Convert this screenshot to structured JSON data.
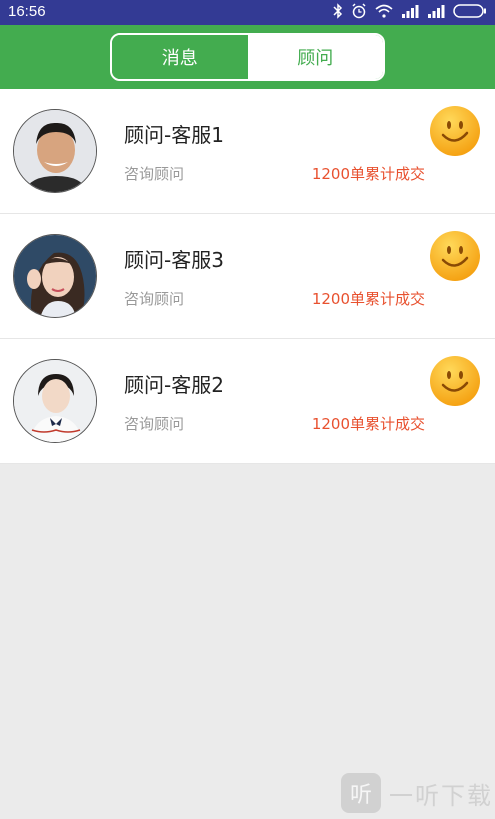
{
  "status_bar": {
    "time": "16:56"
  },
  "tabs": [
    {
      "label": "消息",
      "active": false
    },
    {
      "label": "顾问",
      "active": true
    }
  ],
  "advisors": [
    {
      "name": "顾问-客服1",
      "role": "咨询顾问",
      "deals": "1200单累计成交"
    },
    {
      "name": "顾问-客服3",
      "role": "咨询顾问",
      "deals": "1200单累计成交"
    },
    {
      "name": "顾问-客服2",
      "role": "咨询顾问",
      "deals": "1200单累计成交"
    }
  ],
  "watermark": {
    "logo": "听",
    "text": "一听下载"
  },
  "colors": {
    "status_bar": "#333a94",
    "header": "#43ac4f",
    "deals": "#e8512f",
    "background": "#ebebeb"
  }
}
